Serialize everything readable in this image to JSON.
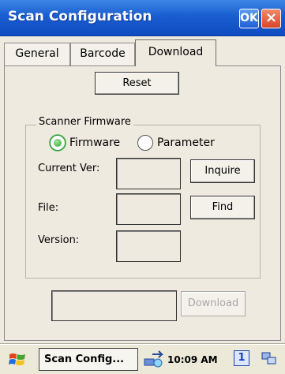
{
  "window": {
    "title": "Scan Configuration",
    "ok_label": "OK",
    "close_label": "×"
  },
  "tabs": [
    {
      "label": "General",
      "selected": false
    },
    {
      "label": "Barcode",
      "selected": false
    },
    {
      "label": "Download",
      "selected": true
    }
  ],
  "main": {
    "reset_label": "Reset",
    "group_label": "Scanner Firmware",
    "radios": [
      {
        "label": "Firmware",
        "selected": true
      },
      {
        "label": "Parameter",
        "selected": false
      }
    ],
    "fields": [
      {
        "label": "Current Ver:",
        "value": ""
      },
      {
        "label": "File:",
        "value": ""
      },
      {
        "label": "Version:",
        "value": ""
      }
    ],
    "inquire_label": "Inquire",
    "find_label": "Find",
    "download_path_value": "",
    "download_label": "Download",
    "download_enabled": false
  },
  "taskbar": {
    "start_icon": "windows-flag-icon",
    "task_label": "Scan Config...",
    "clock": "10:09 AM",
    "input_indicator": "1",
    "network_icon": "network-sync-icon",
    "desktop_icon": "desktop-icon"
  },
  "colors": {
    "titlebar": "#1a5dd0",
    "selected_radio": "#2ea12e",
    "close": "#d8452a"
  }
}
